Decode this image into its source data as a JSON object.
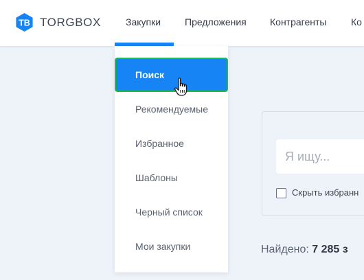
{
  "header": {
    "brand": "TORGBOX",
    "nav": [
      {
        "label": "Закупки",
        "active": true
      },
      {
        "label": "Предложения"
      },
      {
        "label": "Контрагенты"
      },
      {
        "label": "Ко"
      }
    ]
  },
  "dropdown": {
    "items": [
      {
        "label": "Поиск",
        "active": true
      },
      {
        "label": "Рекомендуемые"
      },
      {
        "label": "Избранное"
      },
      {
        "label": "Шаблоны"
      },
      {
        "label": "Черный список"
      },
      {
        "label": "Мои закупки"
      }
    ]
  },
  "search": {
    "placeholder": "Я ищу...",
    "checkbox_label": "Скрыть избранн"
  },
  "results": {
    "found_label": "Найдено:",
    "found_count": "7 285 з"
  },
  "colors": {
    "accent": "#1684f5",
    "focus_outline": "#23b84a",
    "background": "#eef3f9"
  },
  "icons": {
    "logo": "torgbox-logo-icon",
    "cursor": "hand-pointer-icon"
  }
}
